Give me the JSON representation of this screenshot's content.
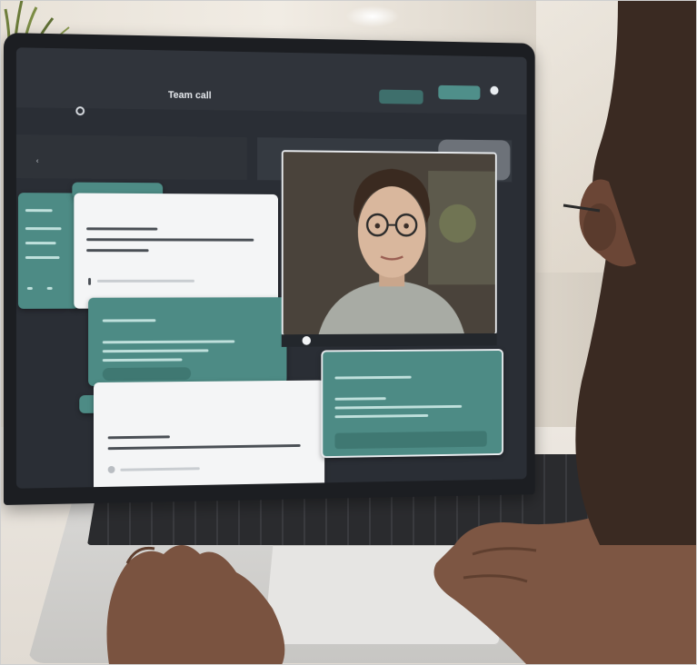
{
  "ui": {
    "title": "Team call",
    "colors": {
      "screen_bg": "#2a2e35",
      "accent_teal": "#4d8b85",
      "card_white": "#f4f5f6"
    },
    "icons": [
      "settings-dot-icon",
      "profile-circle-icon",
      "back-arrow-icon",
      "lock-icon",
      "checkbox-icon"
    ]
  }
}
